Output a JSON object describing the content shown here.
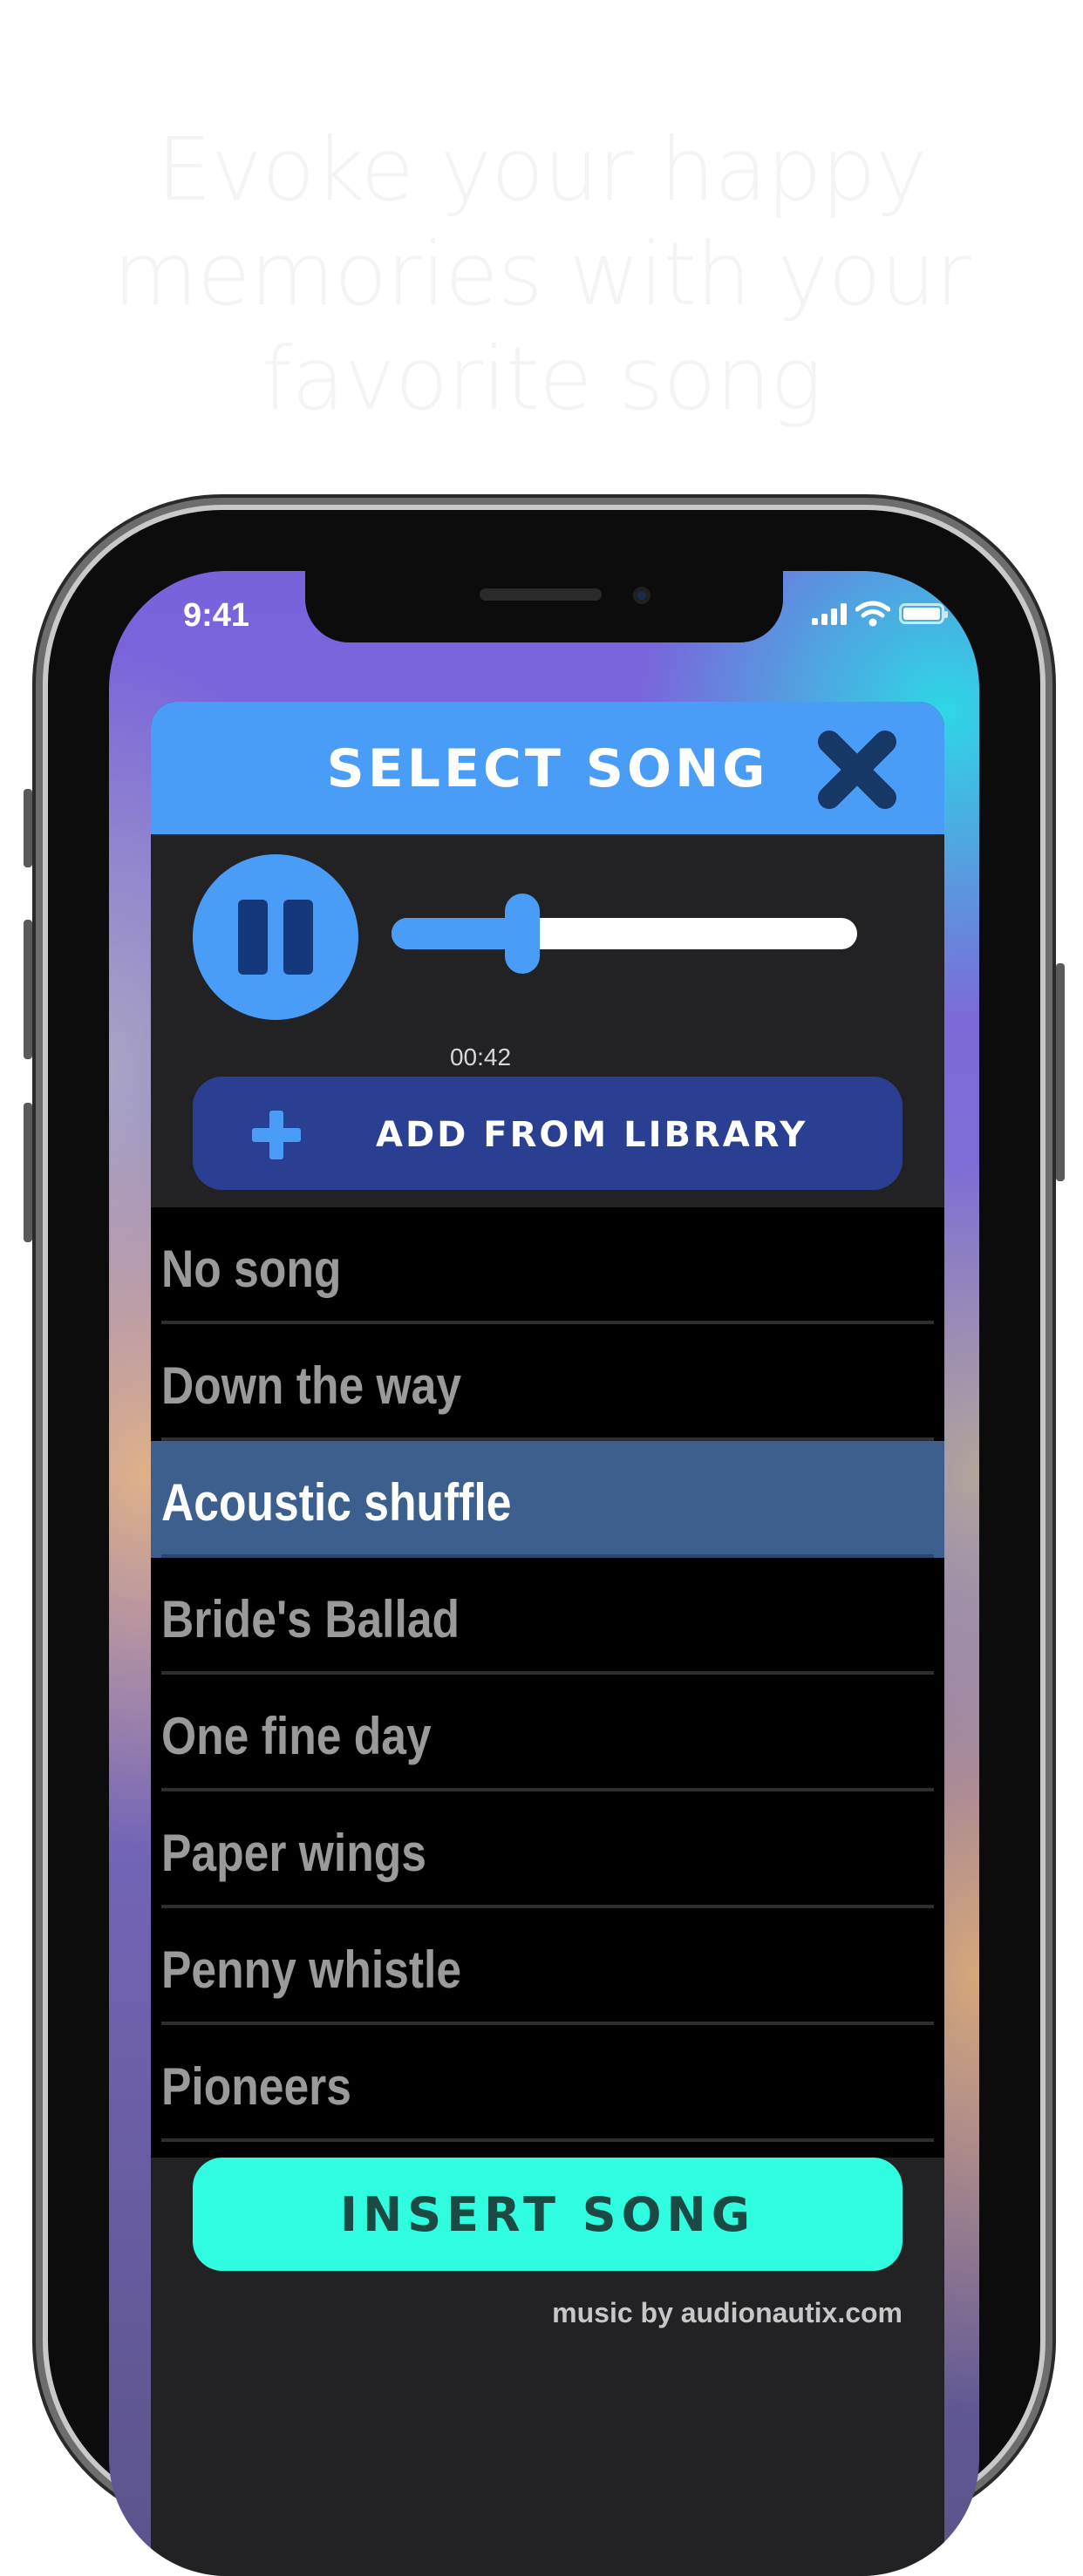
{
  "headline": "Evoke your happy memories with your favorite song",
  "status_bar": {
    "time": "9:41"
  },
  "modal": {
    "title": "SELECT SONG",
    "close_icon": "close-x-icon"
  },
  "player": {
    "state": "playing",
    "play_pause_icon": "pause-icon",
    "position_label": "00:42",
    "progress": 0.28
  },
  "add_from_library": {
    "label": "ADD FROM LIBRARY",
    "icon": "plus-icon"
  },
  "songs": [
    {
      "label": "No song"
    },
    {
      "label": "Down the way"
    },
    {
      "label": "Acoustic shuffle",
      "selected": true
    },
    {
      "label": "Bride's Ballad"
    },
    {
      "label": "One fine day"
    },
    {
      "label": "Paper wings"
    },
    {
      "label": "Penny whistle"
    },
    {
      "label": "Pioneers"
    }
  ],
  "insert_button": {
    "label": "INSERT SONG"
  },
  "credit": "music by audionautix.com",
  "colors": {
    "accent_blue": "#4a9df6",
    "dark_navy": "#2a3f92",
    "insert_teal": "#30fde0",
    "selected_row": "#3c5f8d",
    "panel": "#222224"
  }
}
